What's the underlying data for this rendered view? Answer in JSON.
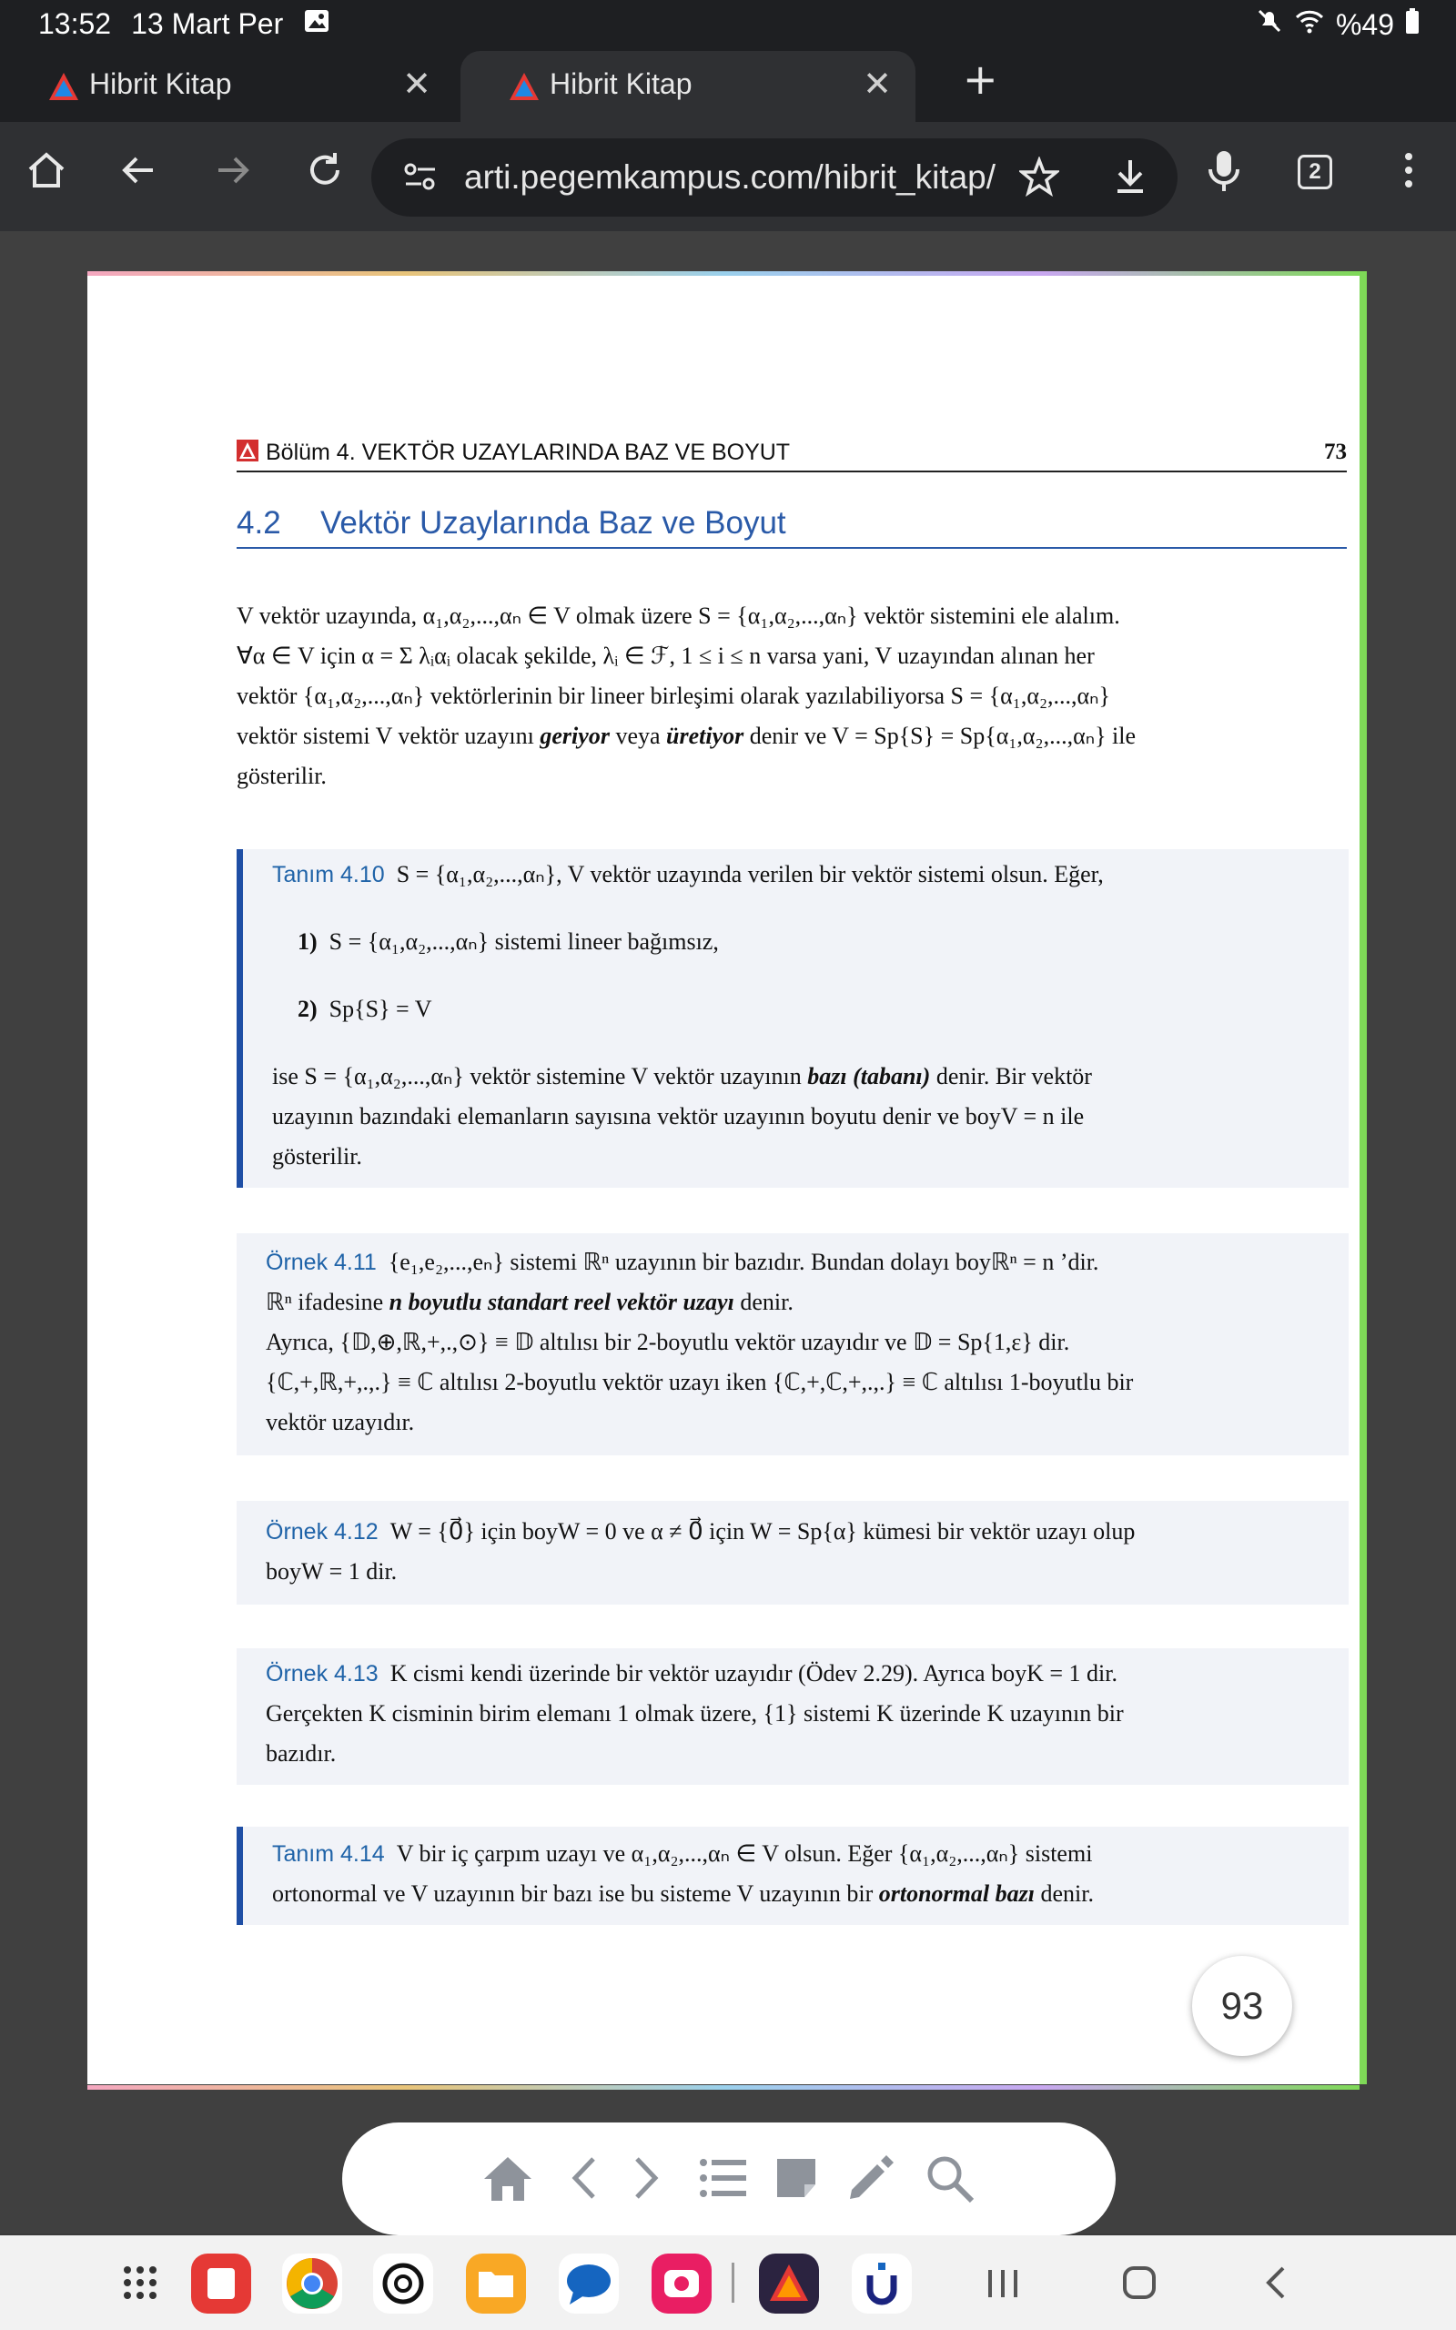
{
  "status": {
    "time": "13:52",
    "date": "13 Mart Per",
    "battery": "%49"
  },
  "tabs": [
    {
      "title": "Hibrit Kitap"
    },
    {
      "title": "Hibrit Kitap"
    }
  ],
  "toolbar": {
    "url": "arti.pegemkampus.com/hibrit_kitap/",
    "tab_count": "2"
  },
  "doc": {
    "chapter": "Bölüm 4.  VEKTÖR UZAYLARINDA BAZ VE BOYUT",
    "page_no": "73",
    "section_num": "4.2",
    "section_title": "Vektör Uzaylarında Baz ve Boyut",
    "p1_l1": "V vektör uzayında, α₁,α₂,...,αₙ ∈ V olmak üzere S = {α₁,α₂,...,αₙ} vektör sistemini ele alalım.",
    "p1_l2": "∀α ∈ V için α = Σ λᵢαᵢ olacak şekilde, λᵢ ∈ ℱ, 1 ≤ i ≤ n varsa yani, V uzayından alınan her",
    "p1_l3": "vektör {α₁,α₂,...,αₙ} vektörlerinin bir lineer birleşimi olarak yazılabiliyorsa S = {α₁,α₂,...,αₙ}",
    "p1_l4a": "vektör sistemi V vektör uzayını ",
    "p1_geriyor": "geriyor",
    "p1_veya": " veya ",
    "p1_uretiyor": "üretiyor",
    "p1_l4b": " denir ve V = Sp{S} = Sp{α₁,α₂,...,αₙ} ile",
    "p1_l5": "gösterilir.",
    "t410_label": "Tanım  4.10",
    "t410_l1": "S = {α₁,α₂,...,αₙ}, V vektör uzayında verilen bir vektör sistemi olsun. Eğer,",
    "t410_i1n": "1)",
    "t410_i1": "S = {α₁,α₂,...,αₙ} sistemi lineer bağımsız,",
    "t410_i2n": "2)",
    "t410_i2": "Sp{S} = V",
    "t410_l4a": "ise S = {α₁,α₂,...,αₙ} vektör sistemine V vektör uzayının ",
    "t410_baz": "bazı (tabanı)",
    "t410_l4b": " denir. Bir vektör",
    "t410_l5": "uzayının bazındaki elemanların sayısına vektör uzayının boyutu denir ve boyV = n ile",
    "t410_l6": "gösterilir.",
    "o411_label": "Örnek  4.11",
    "o411_l1": "{e₁,e₂,...,eₙ} sistemi ℝⁿ uzayının bir bazıdır. Bundan dolayı boyℝⁿ = n ’dir.",
    "o411_l2a": "ℝⁿ ifadesine ",
    "o411_l2b": "n boyutlu standart reel vektör uzayı",
    "o411_l2c": " denir.",
    "o411_l3": "Ayrıca, {𝔻,⊕,ℝ,+,.,⊙} ≡ 𝔻 altılısı bir 2-boyutlu vektör uzayıdır ve 𝔻 = Sp{1,ε} dir.",
    "o411_l4": "{ℂ,+,ℝ,+,.,.} ≡ ℂ altılısı 2-boyutlu vektör uzayı iken {ℂ,+,ℂ,+,.,.} ≡ ℂ altılısı 1-boyutlu bir",
    "o411_l5": "vektör uzayıdır.",
    "o412_label": "Örnek  4.12",
    "o412_l1": "W = {0⃗} için boyW = 0 ve α ≠ 0⃗ için W = Sp{α} kümesi bir vektör uzayı olup",
    "o412_l2": "boyW = 1 dir.",
    "o413_label": "Örnek  4.13",
    "o413_l1": "K cismi kendi üzerinde bir vektör uzayıdır (Ödev 2.29). Ayrıca boyK = 1 dir.",
    "o413_l2": "Gerçekten K cisminin birim elemanı 1 olmak üzere, {1} sistemi K üzerinde K uzayının bir",
    "o413_l3": "bazıdır.",
    "t414_label": "Tanım  4.14",
    "t414_l1": "V bir iç çarpım uzayı ve α₁,α₂,...,αₙ ∈ V olsun. Eğer {α₁,α₂,...,αₙ} sistemi",
    "t414_l2a": "ortonormal ve V uzayının bir bazı ise bu sisteme V uzayının bir ",
    "t414_l2b": "ortonormal bazı",
    "t414_l2c": " denir."
  },
  "viewer_page": "93",
  "colors": {
    "accent": "#1f4fa5",
    "box_bg": "#f1f3f8",
    "frame_green": "#7ed957"
  }
}
